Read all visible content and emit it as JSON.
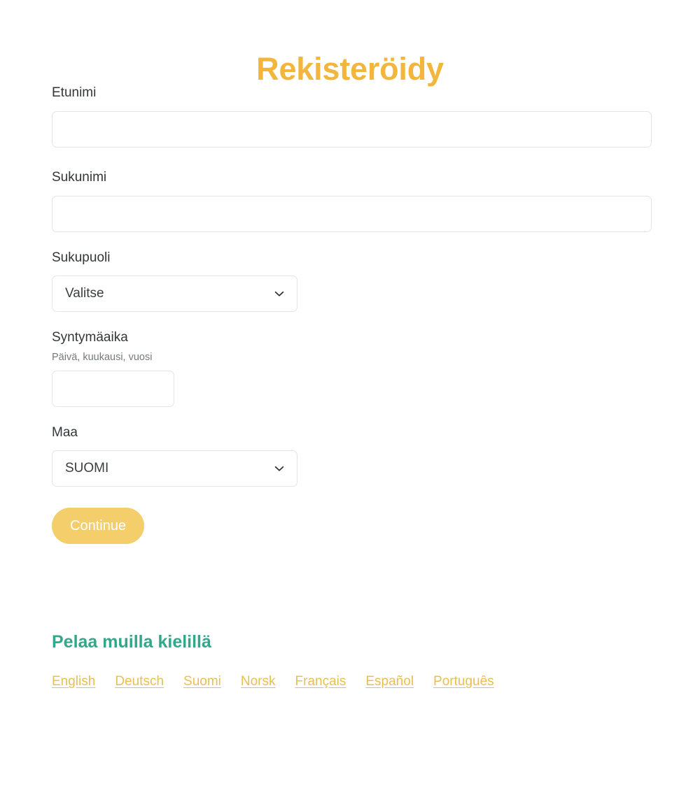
{
  "page": {
    "title": "Rekisteröidy",
    "title_color": "#f2b63c",
    "background": "#ffffff"
  },
  "form": {
    "fields": [
      {
        "id": "first-name",
        "label": "Etunimi",
        "type": "text",
        "value": "",
        "placeholder": ""
      },
      {
        "id": "last-name",
        "label": "Sukunimi",
        "type": "text",
        "value": "",
        "placeholder": ""
      },
      {
        "id": "gender",
        "label": "Sukupuoli",
        "type": "select",
        "value": "Valitse",
        "options": [
          "Valitse"
        ]
      },
      {
        "id": "birthdate",
        "label": "Syntymäaika",
        "hint": "Päivä, kuukausi, vuosi",
        "type": "text",
        "value": "",
        "placeholder": ""
      },
      {
        "id": "country",
        "label": "Maa",
        "type": "select",
        "value": "SUOMI",
        "options": [
          "SUOMI"
        ]
      }
    ],
    "submit_label": "Continue",
    "submit_color": "#f4ce6b"
  },
  "languages": {
    "heading": "Pelaa muilla kielillä",
    "heading_color": "#34a68c",
    "link_color": "#e7bf52",
    "items": [
      {
        "label": "English"
      },
      {
        "label": "Deutsch"
      },
      {
        "label": "Suomi"
      },
      {
        "label": "Norsk"
      },
      {
        "label": "Français"
      },
      {
        "label": "Español"
      },
      {
        "label": "Português"
      }
    ]
  },
  "icons": {
    "chevron_down": "chevron-down-icon"
  }
}
